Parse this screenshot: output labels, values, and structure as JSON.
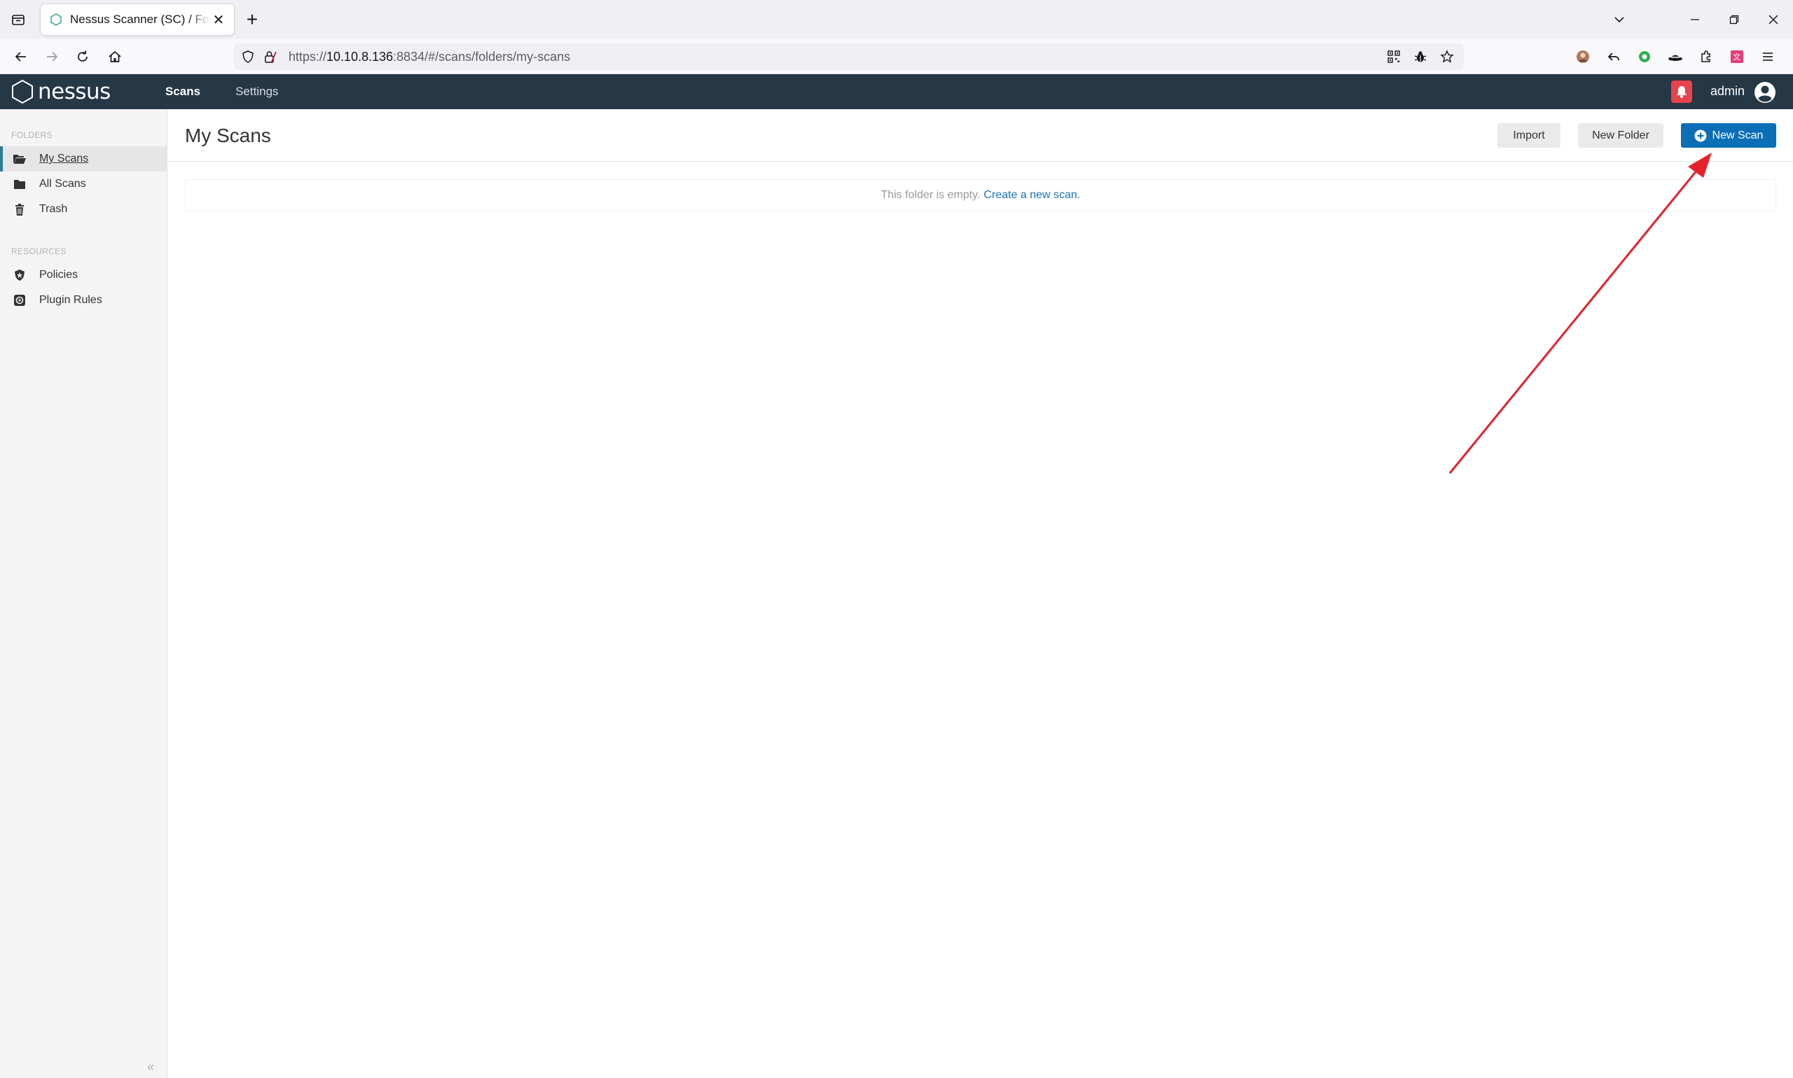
{
  "browser": {
    "tab_title": "Nessus Scanner (SC) / Folders / View",
    "url_prefix": "https://",
    "url_host": "10.10.8.136",
    "url_rest": ":8834/#/scans/folders/my-scans"
  },
  "app": {
    "brand": "nessus",
    "nav": [
      {
        "label": "Scans",
        "active": true
      },
      {
        "label": "Settings",
        "active": false
      }
    ],
    "user": "admin"
  },
  "sidebar": {
    "folders_header": "FOLDERS",
    "folders": [
      {
        "label": "My Scans",
        "icon": "folder-open-icon",
        "active": true
      },
      {
        "label": "All Scans",
        "icon": "folder-icon",
        "active": false
      },
      {
        "label": "Trash",
        "icon": "trash-icon",
        "active": false
      }
    ],
    "resources_header": "RESOURCES",
    "resources": [
      {
        "label": "Policies",
        "icon": "policy-shield-icon"
      },
      {
        "label": "Plugin Rules",
        "icon": "plugin-rules-icon"
      }
    ],
    "collapse_glyph": "«"
  },
  "main": {
    "title": "My Scans",
    "import_label": "Import",
    "new_folder_label": "New Folder",
    "new_scan_label": "New Scan",
    "empty_text": "This folder is empty.",
    "empty_link": "Create a new scan",
    "empty_link_suffix": "."
  },
  "colors": {
    "header_bg": "#263746",
    "primary_button": "#0a6fb7",
    "alert_red": "#e8434c",
    "annotation_arrow": "#e5222b"
  }
}
